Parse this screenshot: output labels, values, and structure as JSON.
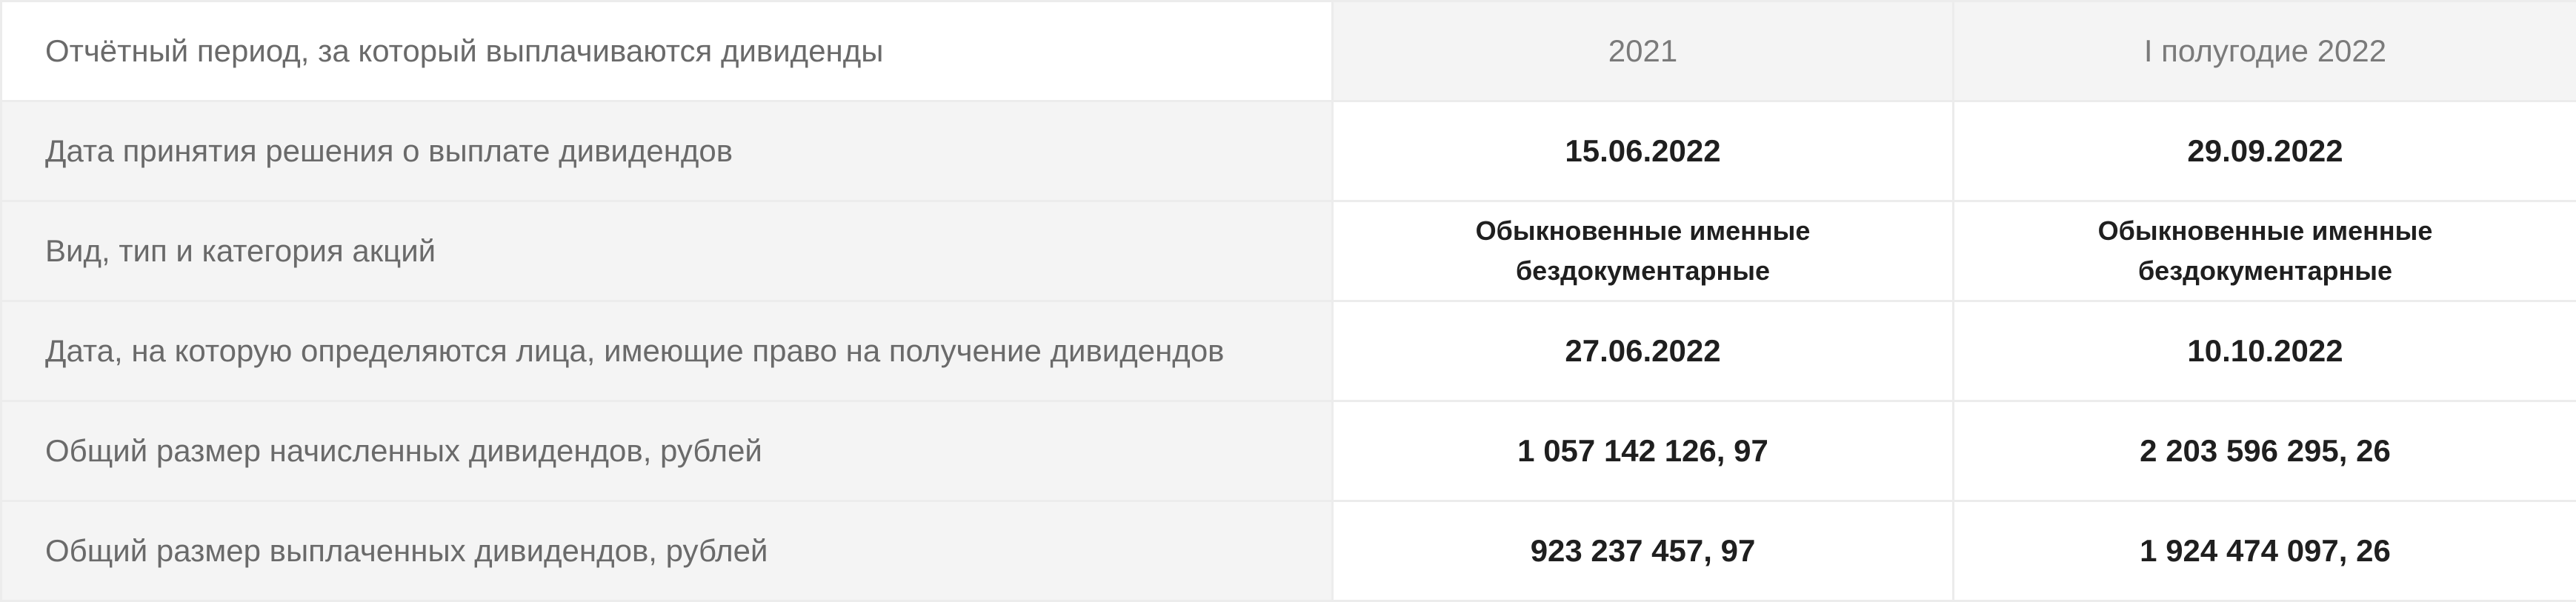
{
  "table": {
    "header": {
      "label": "Отчётный период, за который выплачиваются дивиденды",
      "period_1": "2021",
      "period_2": "I полугодие 2022"
    },
    "rows": [
      {
        "label": "Дата принятия решения о выплате дивидендов",
        "value_1": "15.06.2022",
        "value_2": "29.09.2022"
      },
      {
        "label": "Вид, тип и категория акций",
        "value_1": [
          "Обыкновенные именные",
          "бездокументарные"
        ],
        "value_2": [
          "Обыкновенные именные",
          "бездокументарные"
        ]
      },
      {
        "label": "Дата, на которую определяются лица, имеющие право на получение дивидендов",
        "value_1": "27.06.2022",
        "value_2": "10.10.2022"
      },
      {
        "label": "Общий размер начисленных дивидендов, рублей",
        "value_1": "1 057 142 126, 97",
        "value_2": "2 203 596 295, 26"
      },
      {
        "label": "Общий размер выплаченных дивидендов, рублей",
        "value_1": "923 237 457, 97",
        "value_2": "1 924 474 097, 26"
      }
    ]
  }
}
